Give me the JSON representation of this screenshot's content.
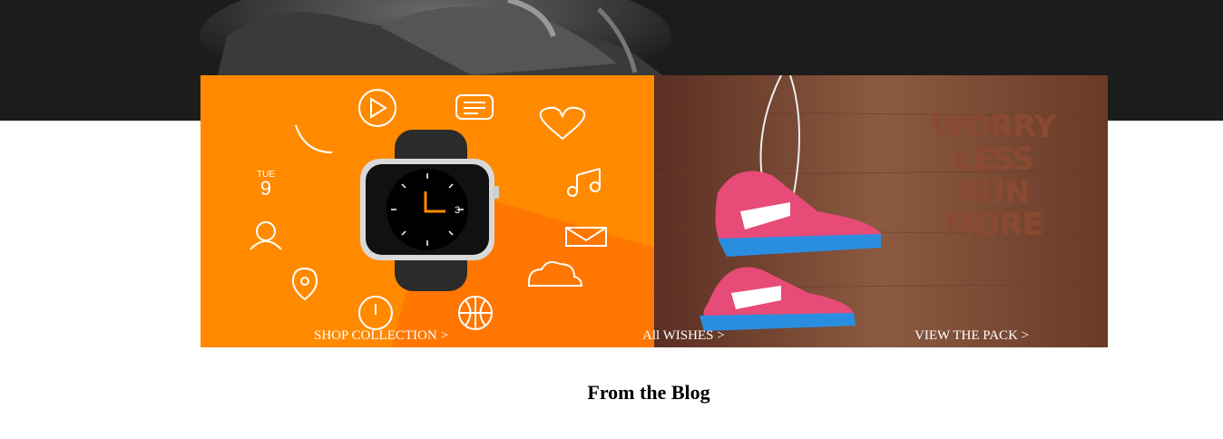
{
  "hero": {
    "background_color": "#1c1c1c"
  },
  "promos": [
    {
      "name": "watch-promo",
      "background_color": "#ff8a00",
      "cta_label": "SHOP COLLECTION >"
    },
    {
      "name": "shoes-promo",
      "background_color": "#7a4630",
      "cta_label": "VIEW THE PACK >",
      "slogan": [
        "WORRY",
        "LESS",
        "RUN",
        "MORE"
      ]
    }
  ],
  "wishes_link": {
    "label": "All WISHES >"
  },
  "watch_face": {
    "day": "TUE",
    "date": "9",
    "dial_number": "3"
  },
  "blog": {
    "title": "From the Blog"
  }
}
